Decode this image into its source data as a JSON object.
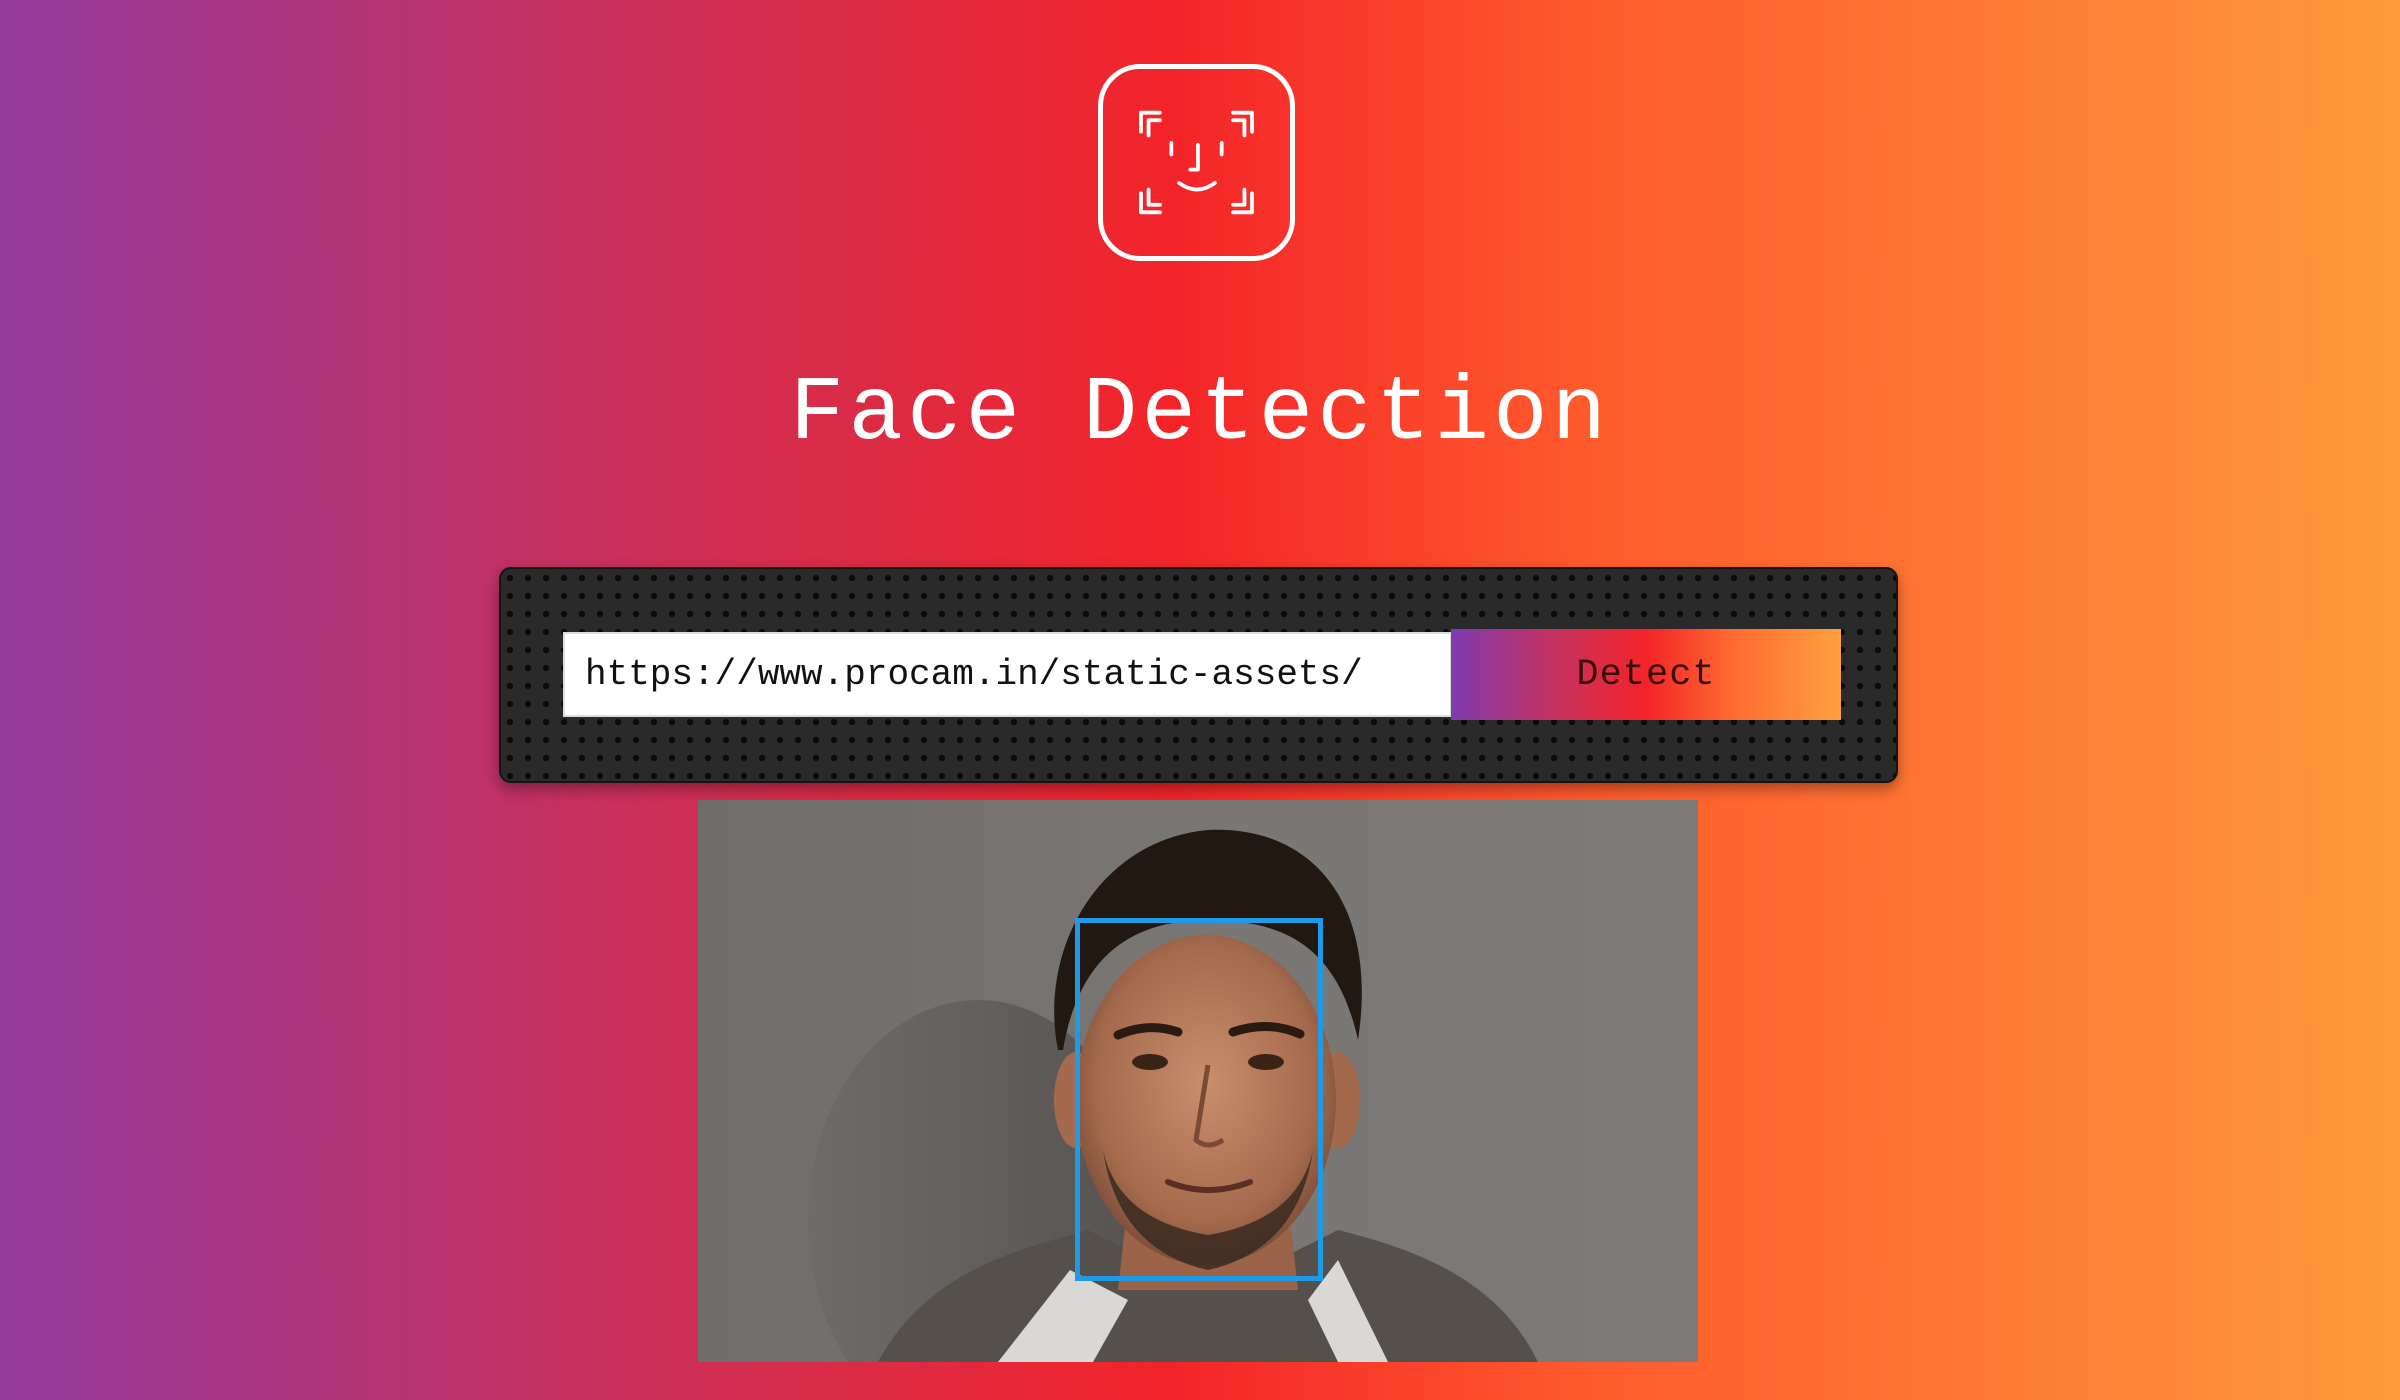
{
  "app": {
    "title": "Face Detection",
    "logo_icon": "face-id-icon"
  },
  "form": {
    "url_value": "https://www.procam.in/static-assets/",
    "detect_label": "Detect"
  },
  "result": {
    "image_icon": "portrait-photo",
    "box_color": "#1f9ae6",
    "faces_detected": 1
  },
  "colors": {
    "gradient": [
      "#923a9e",
      "#c8305c",
      "#f32429",
      "#ff5a2c",
      "#ff9a3c"
    ],
    "panel": "#2a2a2a"
  }
}
